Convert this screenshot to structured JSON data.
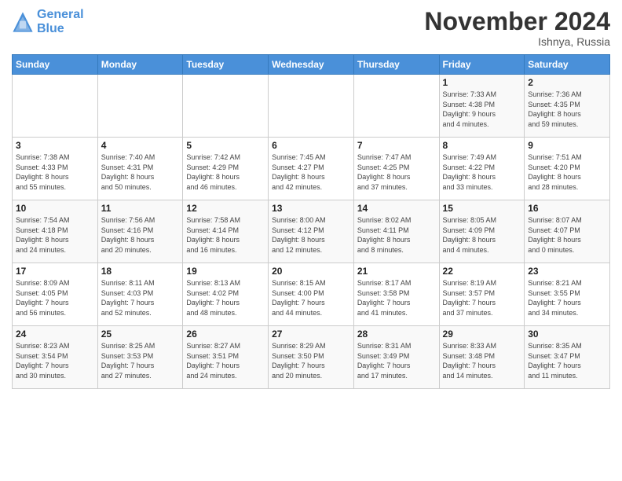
{
  "logo": {
    "line1": "General",
    "line2": "Blue"
  },
  "title": "November 2024",
  "location": "Ishnya, Russia",
  "weekdays": [
    "Sunday",
    "Monday",
    "Tuesday",
    "Wednesday",
    "Thursday",
    "Friday",
    "Saturday"
  ],
  "weeks": [
    [
      {
        "day": "",
        "info": ""
      },
      {
        "day": "",
        "info": ""
      },
      {
        "day": "",
        "info": ""
      },
      {
        "day": "",
        "info": ""
      },
      {
        "day": "",
        "info": ""
      },
      {
        "day": "1",
        "info": "Sunrise: 7:33 AM\nSunset: 4:38 PM\nDaylight: 9 hours\nand 4 minutes."
      },
      {
        "day": "2",
        "info": "Sunrise: 7:36 AM\nSunset: 4:35 PM\nDaylight: 8 hours\nand 59 minutes."
      }
    ],
    [
      {
        "day": "3",
        "info": "Sunrise: 7:38 AM\nSunset: 4:33 PM\nDaylight: 8 hours\nand 55 minutes."
      },
      {
        "day": "4",
        "info": "Sunrise: 7:40 AM\nSunset: 4:31 PM\nDaylight: 8 hours\nand 50 minutes."
      },
      {
        "day": "5",
        "info": "Sunrise: 7:42 AM\nSunset: 4:29 PM\nDaylight: 8 hours\nand 46 minutes."
      },
      {
        "day": "6",
        "info": "Sunrise: 7:45 AM\nSunset: 4:27 PM\nDaylight: 8 hours\nand 42 minutes."
      },
      {
        "day": "7",
        "info": "Sunrise: 7:47 AM\nSunset: 4:25 PM\nDaylight: 8 hours\nand 37 minutes."
      },
      {
        "day": "8",
        "info": "Sunrise: 7:49 AM\nSunset: 4:22 PM\nDaylight: 8 hours\nand 33 minutes."
      },
      {
        "day": "9",
        "info": "Sunrise: 7:51 AM\nSunset: 4:20 PM\nDaylight: 8 hours\nand 28 minutes."
      }
    ],
    [
      {
        "day": "10",
        "info": "Sunrise: 7:54 AM\nSunset: 4:18 PM\nDaylight: 8 hours\nand 24 minutes."
      },
      {
        "day": "11",
        "info": "Sunrise: 7:56 AM\nSunset: 4:16 PM\nDaylight: 8 hours\nand 20 minutes."
      },
      {
        "day": "12",
        "info": "Sunrise: 7:58 AM\nSunset: 4:14 PM\nDaylight: 8 hours\nand 16 minutes."
      },
      {
        "day": "13",
        "info": "Sunrise: 8:00 AM\nSunset: 4:12 PM\nDaylight: 8 hours\nand 12 minutes."
      },
      {
        "day": "14",
        "info": "Sunrise: 8:02 AM\nSunset: 4:11 PM\nDaylight: 8 hours\nand 8 minutes."
      },
      {
        "day": "15",
        "info": "Sunrise: 8:05 AM\nSunset: 4:09 PM\nDaylight: 8 hours\nand 4 minutes."
      },
      {
        "day": "16",
        "info": "Sunrise: 8:07 AM\nSunset: 4:07 PM\nDaylight: 8 hours\nand 0 minutes."
      }
    ],
    [
      {
        "day": "17",
        "info": "Sunrise: 8:09 AM\nSunset: 4:05 PM\nDaylight: 7 hours\nand 56 minutes."
      },
      {
        "day": "18",
        "info": "Sunrise: 8:11 AM\nSunset: 4:03 PM\nDaylight: 7 hours\nand 52 minutes."
      },
      {
        "day": "19",
        "info": "Sunrise: 8:13 AM\nSunset: 4:02 PM\nDaylight: 7 hours\nand 48 minutes."
      },
      {
        "day": "20",
        "info": "Sunrise: 8:15 AM\nSunset: 4:00 PM\nDaylight: 7 hours\nand 44 minutes."
      },
      {
        "day": "21",
        "info": "Sunrise: 8:17 AM\nSunset: 3:58 PM\nDaylight: 7 hours\nand 41 minutes."
      },
      {
        "day": "22",
        "info": "Sunrise: 8:19 AM\nSunset: 3:57 PM\nDaylight: 7 hours\nand 37 minutes."
      },
      {
        "day": "23",
        "info": "Sunrise: 8:21 AM\nSunset: 3:55 PM\nDaylight: 7 hours\nand 34 minutes."
      }
    ],
    [
      {
        "day": "24",
        "info": "Sunrise: 8:23 AM\nSunset: 3:54 PM\nDaylight: 7 hours\nand 30 minutes."
      },
      {
        "day": "25",
        "info": "Sunrise: 8:25 AM\nSunset: 3:53 PM\nDaylight: 7 hours\nand 27 minutes."
      },
      {
        "day": "26",
        "info": "Sunrise: 8:27 AM\nSunset: 3:51 PM\nDaylight: 7 hours\nand 24 minutes."
      },
      {
        "day": "27",
        "info": "Sunrise: 8:29 AM\nSunset: 3:50 PM\nDaylight: 7 hours\nand 20 minutes."
      },
      {
        "day": "28",
        "info": "Sunrise: 8:31 AM\nSunset: 3:49 PM\nDaylight: 7 hours\nand 17 minutes."
      },
      {
        "day": "29",
        "info": "Sunrise: 8:33 AM\nSunset: 3:48 PM\nDaylight: 7 hours\nand 14 minutes."
      },
      {
        "day": "30",
        "info": "Sunrise: 8:35 AM\nSunset: 3:47 PM\nDaylight: 7 hours\nand 11 minutes."
      }
    ]
  ]
}
